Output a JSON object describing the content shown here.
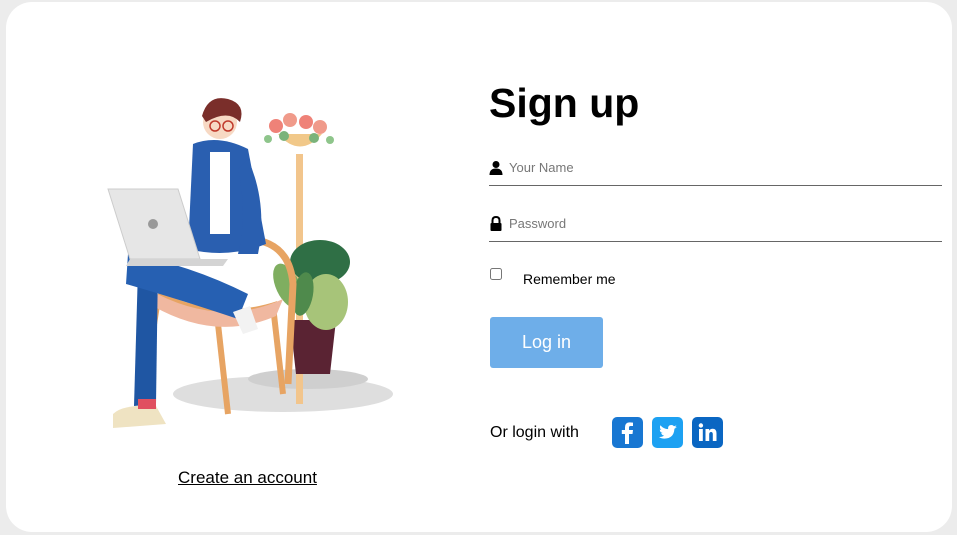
{
  "illustration": {
    "alt": "person sitting on chair with laptop next to plants"
  },
  "left": {
    "create_account": "Create an account"
  },
  "form": {
    "title": "Sign up",
    "name": {
      "placeholder": "Your Name",
      "value": "",
      "icon": "user-icon"
    },
    "password": {
      "placeholder": "Password",
      "value": "",
      "icon": "lock-icon"
    },
    "remember": {
      "label": "Remember me",
      "checked": false
    },
    "login_button": "Log in",
    "or_login_with": "Or login with",
    "social": [
      "facebook-icon",
      "twitter-icon",
      "linkedin-icon"
    ]
  },
  "colors": {
    "button": "#6eaee9",
    "facebook": "#1877d2",
    "twitter": "#1da1f2",
    "linkedin": "#0a66c2"
  }
}
